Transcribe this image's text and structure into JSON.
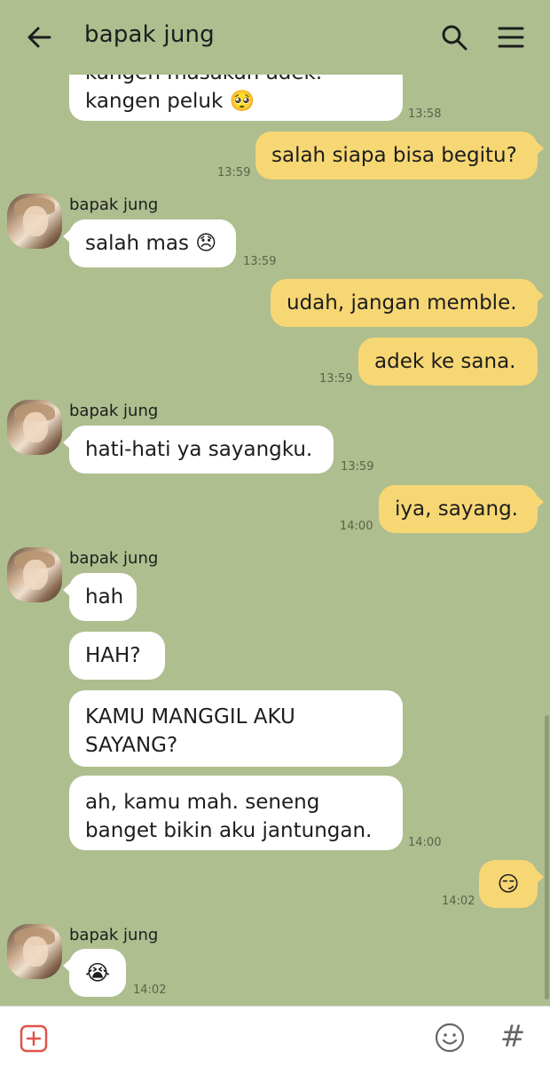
{
  "header": {
    "title": "bapak jung"
  },
  "messages": [
    {
      "lines": [
        "kangen masakan adek.",
        "kangen peluk 🥺"
      ],
      "time": "13:58"
    },
    {
      "text": "salah siapa bisa begitu?",
      "time": "13:59"
    },
    {
      "sender": "bapak jung",
      "text": "salah mas 😞",
      "time": "13:59"
    },
    {
      "text": "udah, jangan memble."
    },
    {
      "text": "adek ke sana.",
      "time": "13:59"
    },
    {
      "sender": "bapak jung",
      "text": "hati-hati ya sayangku.",
      "time": "13:59"
    },
    {
      "text": "iya, sayang.",
      "time": "14:00"
    },
    {
      "sender": "bapak jung",
      "text": "hah"
    },
    {
      "text": "HAH?"
    },
    {
      "lines": [
        "KAMU MANGGIL AKU",
        "SAYANG?"
      ]
    },
    {
      "lines": [
        "ah, kamu mah. seneng",
        "banget bikin aku jantungan."
      ],
      "time": "14:00"
    },
    {
      "text": "😏",
      "time": "14:02"
    },
    {
      "sender": "bapak jung",
      "text": "😭",
      "time": "14:02"
    }
  ],
  "icons": {
    "back": "arrow-left-icon",
    "search": "search-icon",
    "menu": "hamburger-menu-icon",
    "plus": "plus-square-icon",
    "emoji": "smiley-icon",
    "hashtag": "hashtag-icon"
  },
  "bottom_bar": {
    "hashtag_symbol": "#"
  },
  "colors": {
    "background": "#aebe8f",
    "incoming_bubble": "#ffffff",
    "outgoing_bubble": "#f7d774",
    "accent_plus": "#e0534b"
  }
}
